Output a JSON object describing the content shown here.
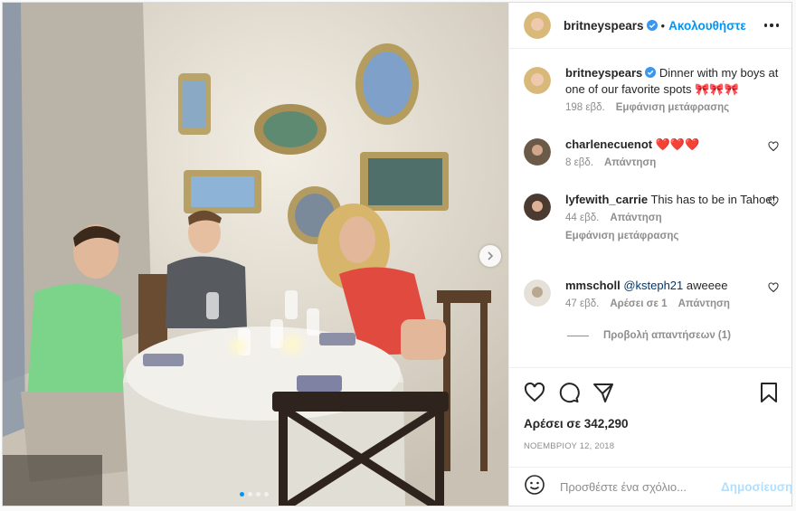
{
  "post": {
    "username": "britneyspears",
    "follow_label": "Ακολουθήστε",
    "separator": "•",
    "caption_username": "britneyspears",
    "caption_text": "Dinner with my boys at one of our favorite spots",
    "caption_emoji": "🎀🎀🎀",
    "caption_time": "198 εβδ.",
    "caption_translate": "Εμφάνιση μετάφρασης",
    "likes": "Αρέσει σε 342,290",
    "date": "ΝΟΕΜΒΡΙΟΥ 12, 2018",
    "comment_placeholder": "Προσθέστε ένα σχόλιο...",
    "post_label": "Δημοσίευση",
    "carousel": {
      "slides": 4,
      "active": 1
    }
  },
  "comments": [
    {
      "username": "charlenecuenot",
      "text": "❤️❤️❤️",
      "time": "8 εβδ.",
      "reply": "Απάντηση",
      "avatar_color": "#6b5a48"
    },
    {
      "username": "lyfewith_carrie",
      "text": "This has to be in Tahoe!",
      "time": "44 εβδ.",
      "reply": "Απάντηση",
      "translate": "Εμφάνιση μετάφρασης",
      "avatar_color": "#4a3a30"
    },
    {
      "username": "mmscholl",
      "mention": "@ksteph21",
      "text": " aweeee",
      "time": "47 εβδ.",
      "likes": "Αρέσει σε 1",
      "reply": "Απάντηση",
      "avatar_color": "#b9a88f"
    }
  ],
  "view_replies": "Προβολή απαντήσεων (1)",
  "colors": {
    "accent": "#0095f6",
    "verified": "#3897f0",
    "muted": "#8e8e8e",
    "post_disabled": "#b2dffc",
    "shirt": "#e04a3f"
  }
}
